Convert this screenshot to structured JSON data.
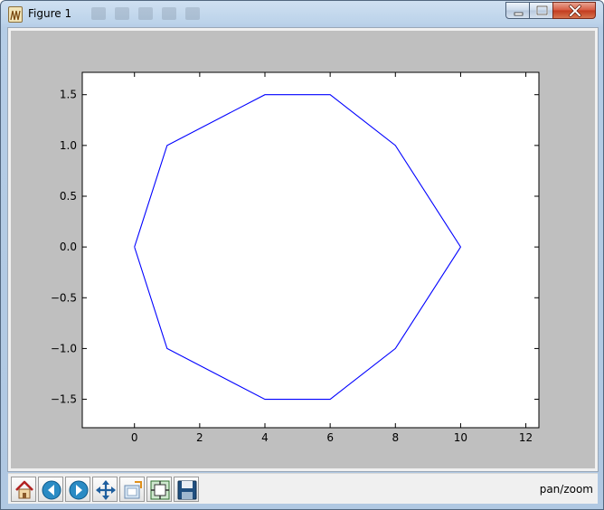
{
  "window": {
    "title": "Figure 1"
  },
  "caption_buttons": {
    "minimize_icon": "minimize-icon",
    "maximize_icon": "maximize-icon",
    "close_icon": "close-icon"
  },
  "toolbar": {
    "buttons": [
      {
        "name": "home",
        "icon": "home-icon"
      },
      {
        "name": "back",
        "icon": "back-arrow-icon"
      },
      {
        "name": "forward",
        "icon": "forward-arrow-icon"
      },
      {
        "name": "pan",
        "icon": "pan-arrows-icon"
      },
      {
        "name": "zoom",
        "icon": "zoom-rect-icon"
      },
      {
        "name": "subplots",
        "icon": "subplots-icon"
      },
      {
        "name": "save",
        "icon": "floppy-disk-icon"
      }
    ],
    "status": "pan/zoom"
  },
  "colors": {
    "line": "#0000ff",
    "figure_bg": "#bfbfbf",
    "axes_bg": "#ffffff",
    "titlebar": "#bcd3ea"
  },
  "chart_data": {
    "type": "line",
    "title": "",
    "xlabel": "",
    "ylabel": "",
    "xlim": [
      -1.6,
      12.4
    ],
    "ylim": [
      -1.78,
      1.72
    ],
    "xticks": [
      0,
      2,
      4,
      6,
      8,
      10,
      12
    ],
    "yticks": [
      -1.5,
      -1.0,
      -0.5,
      0.0,
      0.5,
      1.0,
      1.5
    ],
    "xtick_labels": [
      "0",
      "2",
      "4",
      "6",
      "8",
      "10",
      "12"
    ],
    "ytick_labels": [
      "−1.5",
      "−1.0",
      "−0.5",
      "0.0",
      "0.5",
      "1.0",
      "1.5"
    ],
    "grid": false,
    "series": [
      {
        "x": [
          0,
          1,
          4,
          6,
          8,
          10,
          8,
          6,
          4,
          1,
          0
        ],
        "y": [
          0,
          1,
          1.5,
          1.5,
          1,
          0,
          -1,
          -1.5,
          -1.5,
          -1,
          0
        ]
      }
    ]
  }
}
